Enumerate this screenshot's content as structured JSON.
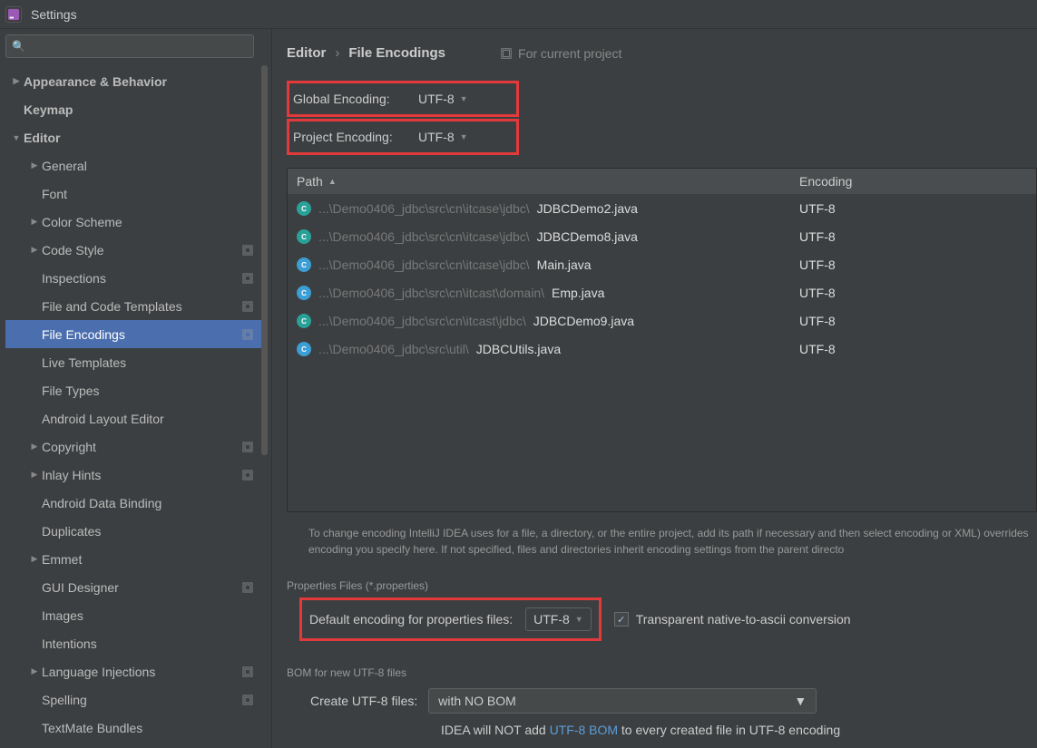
{
  "title": "Settings",
  "sidebar": {
    "search_placeholder": "",
    "items": [
      {
        "label": "Appearance & Behavior",
        "depth": 0,
        "arrow": "closed",
        "bold": true,
        "badge": false
      },
      {
        "label": "Keymap",
        "depth": 0,
        "arrow": "none",
        "bold": true,
        "badge": false
      },
      {
        "label": "Editor",
        "depth": 0,
        "arrow": "open",
        "bold": true,
        "badge": false
      },
      {
        "label": "General",
        "depth": 1,
        "arrow": "closed",
        "bold": false,
        "badge": false
      },
      {
        "label": "Font",
        "depth": 1,
        "arrow": "none",
        "bold": false,
        "badge": false
      },
      {
        "label": "Color Scheme",
        "depth": 1,
        "arrow": "closed",
        "bold": false,
        "badge": false
      },
      {
        "label": "Code Style",
        "depth": 1,
        "arrow": "closed",
        "bold": false,
        "badge": true
      },
      {
        "label": "Inspections",
        "depth": 1,
        "arrow": "none",
        "bold": false,
        "badge": true
      },
      {
        "label": "File and Code Templates",
        "depth": 1,
        "arrow": "none",
        "bold": false,
        "badge": true
      },
      {
        "label": "File Encodings",
        "depth": 1,
        "arrow": "none",
        "bold": false,
        "badge": true,
        "selected": true
      },
      {
        "label": "Live Templates",
        "depth": 1,
        "arrow": "none",
        "bold": false,
        "badge": false
      },
      {
        "label": "File Types",
        "depth": 1,
        "arrow": "none",
        "bold": false,
        "badge": false
      },
      {
        "label": "Android Layout Editor",
        "depth": 1,
        "arrow": "none",
        "bold": false,
        "badge": false
      },
      {
        "label": "Copyright",
        "depth": 1,
        "arrow": "closed",
        "bold": false,
        "badge": true
      },
      {
        "label": "Inlay Hints",
        "depth": 1,
        "arrow": "closed",
        "bold": false,
        "badge": true
      },
      {
        "label": "Android Data Binding",
        "depth": 1,
        "arrow": "none",
        "bold": false,
        "badge": false
      },
      {
        "label": "Duplicates",
        "depth": 1,
        "arrow": "none",
        "bold": false,
        "badge": false
      },
      {
        "label": "Emmet",
        "depth": 1,
        "arrow": "closed",
        "bold": false,
        "badge": false
      },
      {
        "label": "GUI Designer",
        "depth": 1,
        "arrow": "none",
        "bold": false,
        "badge": true
      },
      {
        "label": "Images",
        "depth": 1,
        "arrow": "none",
        "bold": false,
        "badge": false
      },
      {
        "label": "Intentions",
        "depth": 1,
        "arrow": "none",
        "bold": false,
        "badge": false
      },
      {
        "label": "Language Injections",
        "depth": 1,
        "arrow": "closed",
        "bold": false,
        "badge": true
      },
      {
        "label": "Spelling",
        "depth": 1,
        "arrow": "none",
        "bold": false,
        "badge": true
      },
      {
        "label": "TextMate Bundles",
        "depth": 1,
        "arrow": "none",
        "bold": false,
        "badge": false
      }
    ]
  },
  "breadcrumb": {
    "root": "Editor",
    "sep": "›",
    "leaf": "File Encodings",
    "for_project": "For current project"
  },
  "globalEnc": {
    "label": "Global Encoding:",
    "value": "UTF-8"
  },
  "projectEnc": {
    "label": "Project Encoding:",
    "value": "UTF-8"
  },
  "table": {
    "headers": {
      "path": "Path",
      "encoding": "Encoding"
    },
    "rows": [
      {
        "gray": "...\\Demo0406_jdbc\\src\\cn\\itcase\\jdbc\\",
        "white": "JDBCDemo2.java",
        "enc": "UTF-8",
        "icon": "c1"
      },
      {
        "gray": "...\\Demo0406_jdbc\\src\\cn\\itcase\\jdbc\\",
        "white": "JDBCDemo8.java",
        "enc": "UTF-8",
        "icon": "c1"
      },
      {
        "gray": "...\\Demo0406_jdbc\\src\\cn\\itcase\\jdbc\\",
        "white": "Main.java",
        "enc": "UTF-8",
        "icon": "c2"
      },
      {
        "gray": "...\\Demo0406_jdbc\\src\\cn\\itcast\\domain\\",
        "white": "Emp.java",
        "enc": "UTF-8",
        "icon": "c2"
      },
      {
        "gray": "...\\Demo0406_jdbc\\src\\cn\\itcast\\jdbc\\",
        "white": "JDBCDemo9.java",
        "enc": "UTF-8",
        "icon": "c1"
      },
      {
        "gray": "...\\Demo0406_jdbc\\src\\util\\",
        "white": "JDBCUtils.java",
        "enc": "UTF-8",
        "icon": "c2"
      }
    ]
  },
  "helpText": "To change encoding IntelliJ IDEA uses for a file, a directory, or the entire project, add its path if necessary and then select encoding or XML) overrides encoding you specify here. If not specified, files and directories inherit encoding settings from the parent directo",
  "propsSection": {
    "title": "Properties Files (*.properties)",
    "label": "Default encoding for properties files:",
    "value": "UTF-8",
    "checkboxLabel": "Transparent native-to-ascii conversion"
  },
  "bomSection": {
    "title": "BOM for new UTF-8 files",
    "label": "Create UTF-8 files:",
    "value": "with NO BOM",
    "note_pre": "IDEA will NOT add ",
    "note_link": "UTF-8 BOM",
    "note_post": " to every created file in UTF-8 encoding"
  }
}
